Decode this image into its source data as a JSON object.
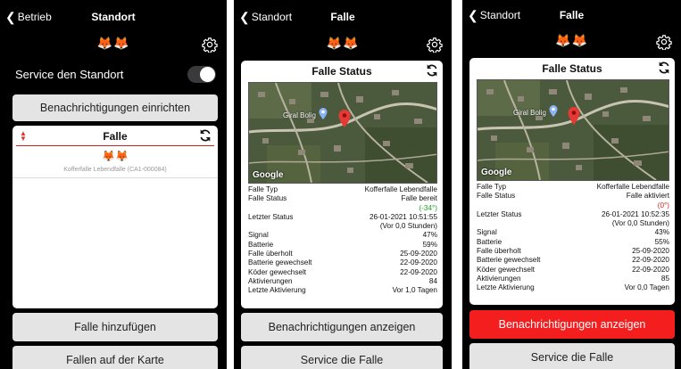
{
  "screen1": {
    "back": "Betrieb",
    "title": "Standort",
    "foxes": "🦊🦊",
    "service_label": "Service den Standort",
    "notify_button": "Benachrichtigungen einrichten",
    "trap_card": {
      "title": "Falle",
      "foxes": "🦊🦊",
      "subtitle": "Kofferfalle Lebendfalle (CA1-000084)"
    },
    "add_trap_button": "Falle hinzufügen",
    "map_button": "Fallen auf der Karte"
  },
  "screen2": {
    "back": "Standort",
    "title": "Falle",
    "foxes": "🦊🦊",
    "card_title": "Falle Status",
    "map_place": "Giral Bolig",
    "map_brand": "Google",
    "labels": {
      "type": "Falle Typ",
      "status": "Falle Status",
      "last_status": "Letzter Status",
      "signal": "Signal",
      "battery": "Batterie",
      "overhauled": "Falle überholt",
      "battery_changed": "Batterie gewechselt",
      "bait_changed": "Köder gewechselt",
      "activations": "Aktivierungen",
      "last_activation": "Letzte Aktivierung"
    },
    "values": {
      "type": "Kofferfalle Lebendfalle",
      "status": "Falle bereit",
      "status_note": "(-34°)",
      "last_status": "26-01-2021 10:51:55",
      "last_status_ago": "(Vor 0,0 Stunden)",
      "signal": "47%",
      "battery": "59%",
      "overhauled": "25-09-2020",
      "battery_changed": "22-09-2020",
      "bait_changed": "22-09-2020",
      "activations": "84",
      "last_activation": "Vor 1,0 Tagen"
    },
    "notify_button": "Benachrichtigungen anzeigen",
    "service_button": "Service die Falle"
  },
  "screen3": {
    "back": "Standort",
    "title": "Falle",
    "foxes": "🦊🦊",
    "card_title": "Falle Status",
    "map_place": "Giral Bolig",
    "map_brand": "Google",
    "labels": {
      "type": "Falle Typ",
      "status": "Falle Status",
      "last_status": "Letzter Status",
      "signal": "Signal",
      "battery": "Batterie",
      "overhauled": "Falle überholt",
      "battery_changed": "Batterie gewechselt",
      "bait_changed": "Köder gewechselt",
      "activations": "Aktivierungen",
      "last_activation": "Letzte Aktivierung"
    },
    "values": {
      "type": "Kofferfalle Lebendfalle",
      "status": "Falle aktiviert",
      "status_note": "(0°)",
      "last_status": "26-01-2021 10:52:35",
      "last_status_ago": "(Vor 0,0 Stunden)",
      "signal": "43%",
      "battery": "55%",
      "overhauled": "25-09-2020",
      "battery_changed": "22-09-2020",
      "bait_changed": "22-09-2020",
      "activations": "85",
      "last_activation": "Vor 0,0 Tagen"
    },
    "notify_button": "Benachrichtigungen anzeigen",
    "service_button": "Service die Falle"
  },
  "colors": {
    "background": "#000000",
    "button": "#e4e4e4",
    "alert_button": "#f41e1e",
    "status_ok": "#21a02a",
    "status_alert": "#e02020",
    "map_pin": "#e53935"
  },
  "icons": {
    "back": "chevron-left-icon",
    "settings": "gear-icon",
    "refresh": "refresh-icon",
    "sort": "up-down-arrows-icon",
    "map_pin": "map-pin-icon",
    "place_pin": "place-marker-icon"
  }
}
